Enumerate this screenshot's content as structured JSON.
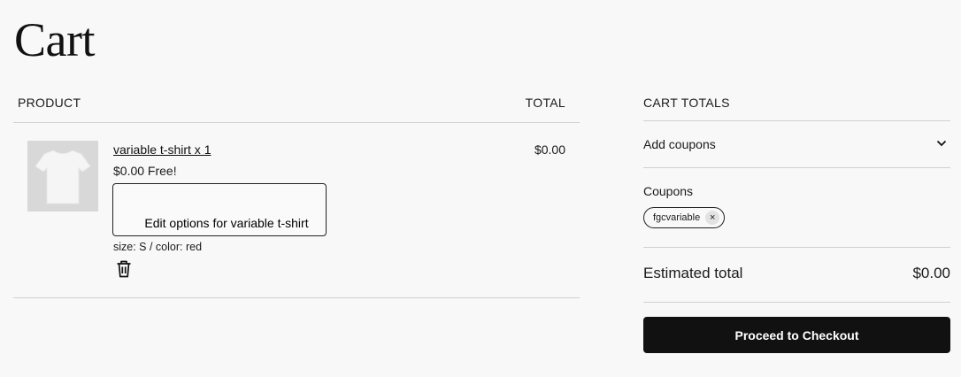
{
  "page": {
    "title": "Cart"
  },
  "table": {
    "product_header": "PRODUCT",
    "total_header": "TOTAL",
    "item": {
      "name": "variable t-shirt x 1",
      "price": "$0.00 Free!",
      "edit_label": "Edit options for variable t-shirt",
      "variation": "size: S / color: red",
      "total": "$0.00"
    }
  },
  "totals": {
    "header": "CART TOTALS",
    "add_coupons": "Add coupons",
    "coupons_label": "Coupons",
    "coupon_code": "fgcvariable",
    "coupon_remove": "×",
    "estimated_label": "Estimated total",
    "estimated_value": "$0.00",
    "checkout_label": "Proceed to Checkout"
  },
  "icons": [
    "tshirt-image",
    "trash-icon",
    "chevron-down-icon",
    "close-icon"
  ]
}
